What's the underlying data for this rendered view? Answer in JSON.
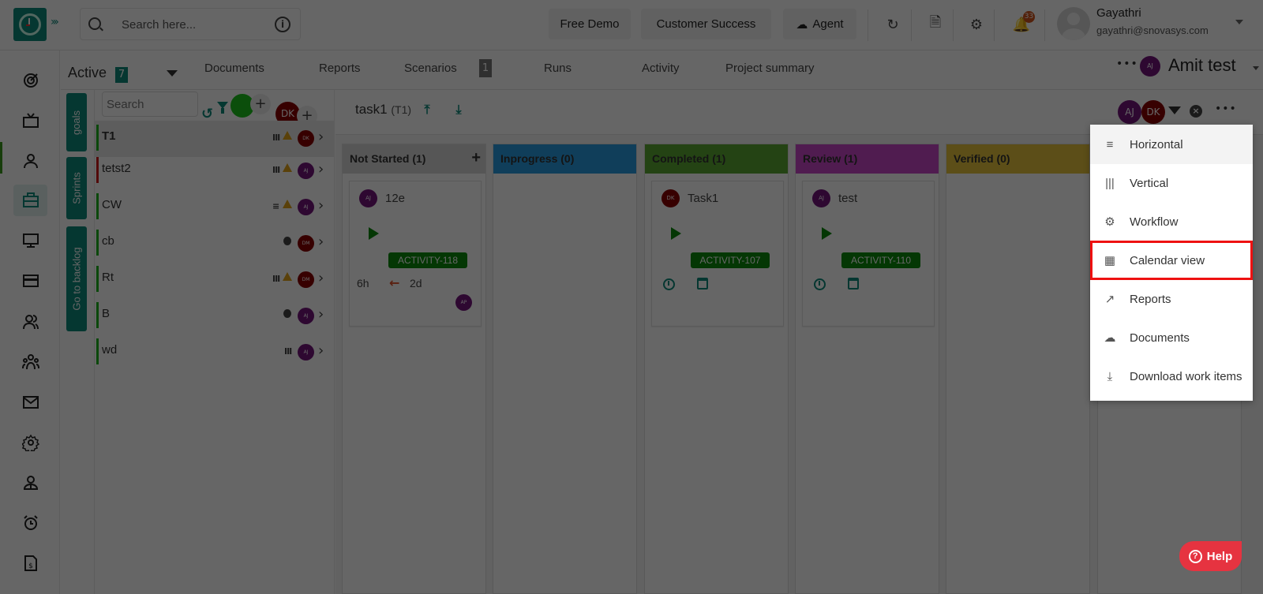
{
  "header": {
    "search_placeholder": "Search here...",
    "buttons": {
      "free_demo": "Free Demo",
      "customer_success": "Customer Success",
      "agent": "Agent"
    },
    "notification_count": "33",
    "user": {
      "name": "Gayathri",
      "email": "gayathri@snovasys.com"
    }
  },
  "sidebar": {
    "items": [
      {
        "icon": "target-icon"
      },
      {
        "icon": "tv-icon"
      },
      {
        "icon": "user-icon"
      },
      {
        "icon": "briefcase-icon",
        "active": true
      },
      {
        "icon": "monitor-icon"
      },
      {
        "icon": "credit-card-icon"
      },
      {
        "icon": "users-icon"
      },
      {
        "icon": "team-icon"
      },
      {
        "icon": "mail-icon"
      },
      {
        "icon": "settings-icon"
      },
      {
        "icon": "profile-icon"
      },
      {
        "icon": "alarm-icon"
      },
      {
        "icon": "invoice-icon"
      }
    ]
  },
  "project_bar": {
    "active_label": "Active",
    "active_count": "7",
    "tabs": [
      {
        "label": "Documents"
      },
      {
        "label": "Reports"
      },
      {
        "label": "Scenarios",
        "count": "1"
      },
      {
        "label": "Runs"
      },
      {
        "label": "Activity"
      },
      {
        "label": "Project summary"
      }
    ],
    "project_avatar": "AJ",
    "project_name": "Amit test"
  },
  "vertical_tabs": [
    "goals",
    "Sprints",
    "Go to backlog"
  ],
  "work_items": {
    "search_placeholder": "Search",
    "avatar_initials": "DK",
    "items": [
      {
        "title": "T1",
        "priority": "III",
        "warning": true,
        "avatar": "DK",
        "avatar_color": "#8b0000",
        "bar": "green",
        "selected": true
      },
      {
        "title": "tetst2",
        "priority": "III",
        "warning": true,
        "avatar": "AJ",
        "avatar_color": "#74147c",
        "bar": "red"
      },
      {
        "title": "CW",
        "priority": "≡",
        "warning": true,
        "avatar": "AJ",
        "avatar_color": "#74147c",
        "bar": "green"
      },
      {
        "title": "cb",
        "bug": true,
        "avatar": "DM",
        "avatar_color": "#8b0000",
        "bar": "green"
      },
      {
        "title": "Rt",
        "priority": "III",
        "warning": true,
        "avatar": "DM",
        "avatar_color": "#8b0000",
        "bar": "green"
      },
      {
        "title": "B",
        "bug": true,
        "avatar": "AJ",
        "avatar_color": "#74147c",
        "bar": "green"
      },
      {
        "title": "wd",
        "priority": "III",
        "avatar": "AJ",
        "avatar_color": "#74147c",
        "bar": "green"
      }
    ]
  },
  "board": {
    "title": "task1",
    "code": "(T1)",
    "header_avatars": [
      {
        "initials": "AJ",
        "color": "#74147c"
      },
      {
        "initials": "DK",
        "color": "#8b0000"
      }
    ],
    "columns": [
      {
        "name": "Not Started (1)",
        "color": "#d6d6d6",
        "add": true,
        "card": {
          "avatar": "AJ",
          "avatar_color": "#74147c",
          "title": "12e",
          "tag": "ACTIVITY-118",
          "estimate": "6h",
          "days": "2d",
          "assignee": "AP"
        }
      },
      {
        "name": "Inprogress (0)",
        "color": "#2a9be0"
      },
      {
        "name": "Completed (1)",
        "color": "#5aa832",
        "card": {
          "avatar": "DK",
          "avatar_color": "#8b0000",
          "title": "Task1",
          "tag": "ACTIVITY-107"
        }
      },
      {
        "name": "Review (1)",
        "color": "#c848c8",
        "card": {
          "avatar": "AJ",
          "avatar_color": "#74147c",
          "title": "test",
          "tag": "ACTIVITY-110"
        }
      },
      {
        "name": "Verified (0)",
        "color": "#e6c43c"
      },
      {
        "name": "",
        "color": "#5aa832"
      }
    ]
  },
  "view_menu": {
    "items": [
      {
        "label": "Horizontal",
        "icon": "menu-lines-icon",
        "glyph": "≡"
      },
      {
        "label": "Vertical",
        "icon": "vertical-bars-icon",
        "glyph": "|||"
      },
      {
        "label": "Workflow",
        "icon": "gear-icon",
        "glyph": "⚙"
      },
      {
        "label": "Calendar view",
        "icon": "calendar-icon",
        "glyph": "▦",
        "highlighted": true
      },
      {
        "label": "Reports",
        "icon": "chart-icon",
        "glyph": "↗"
      },
      {
        "label": "Documents",
        "icon": "cloud-upload-icon",
        "glyph": "☁"
      },
      {
        "label": "Download work items",
        "icon": "download-icon",
        "glyph": "⤓"
      }
    ]
  },
  "help": {
    "label": "Help"
  }
}
